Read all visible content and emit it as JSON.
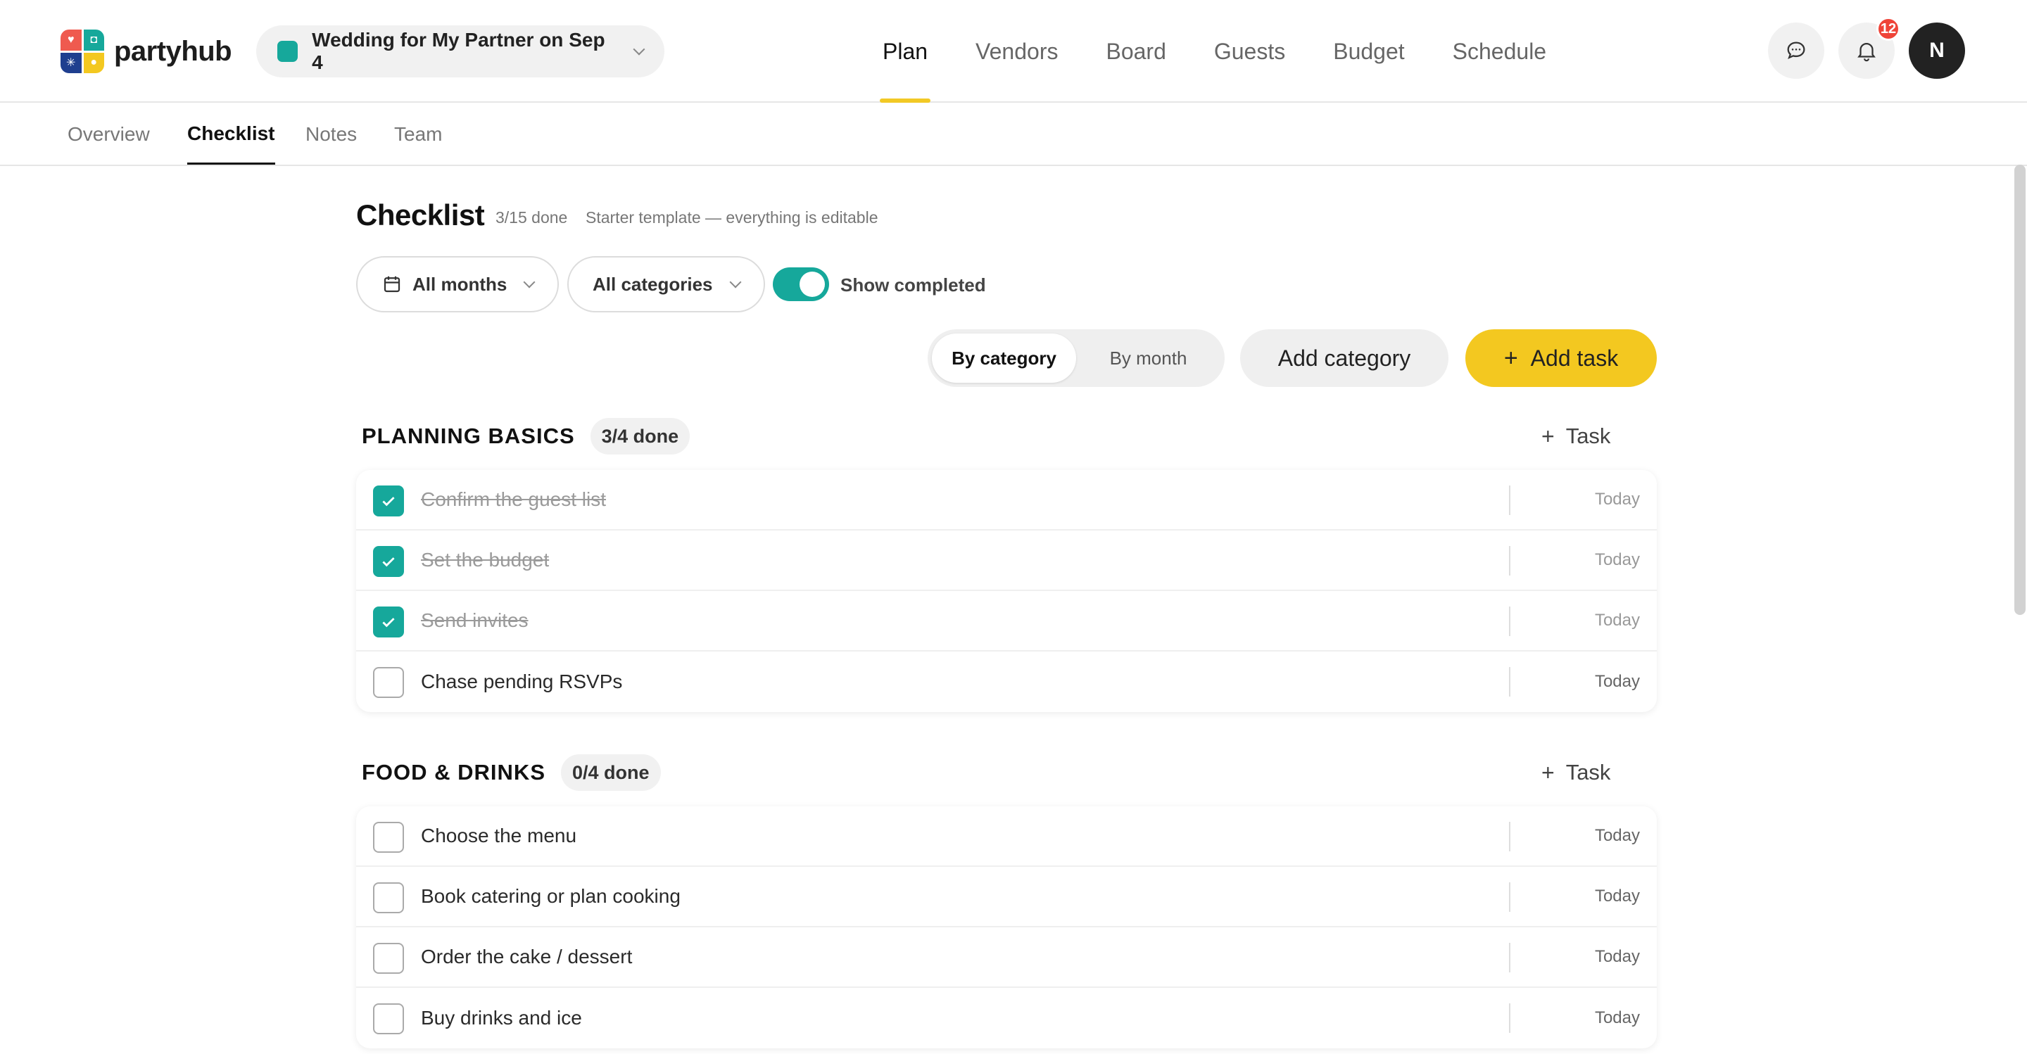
{
  "app": {
    "name": "partyhub",
    "colors": {
      "brand_yellow": "#f3c820",
      "teal": "#16a89b",
      "badge_red": "#ef4438"
    }
  },
  "event": {
    "name": "Wedding for My Partner on Sep 4"
  },
  "main_nav": [
    {
      "label": "Plan",
      "active": true
    },
    {
      "label": "Vendors"
    },
    {
      "label": "Board"
    },
    {
      "label": "Guests"
    },
    {
      "label": "Budget"
    },
    {
      "label": "Schedule"
    }
  ],
  "header": {
    "notifications_count": "12",
    "avatar_initial": "N",
    "icons": [
      "chat-icon",
      "bell-icon"
    ]
  },
  "sub_tabs": [
    {
      "label": "Overview"
    },
    {
      "label": "Checklist",
      "active": true
    },
    {
      "label": "Notes"
    },
    {
      "label": "Team"
    }
  ],
  "checklist": {
    "title": "Checklist",
    "done_summary": "3/15 done",
    "template_note": "Starter template — everything is editable",
    "filters": {
      "months": "All months",
      "categories": "All categories"
    },
    "show_completed": {
      "label": "Show completed",
      "on": true
    },
    "view_toggle": {
      "by_category": "By category",
      "by_month": "By month",
      "selected": "By category"
    },
    "add_category": "Add category",
    "add_task": "Add task"
  },
  "categories": [
    {
      "name": "PLANNING BASICS",
      "count": "3/4 done",
      "add_label": "Task",
      "tasks": [
        {
          "title": "Confirm the guest list",
          "done": true,
          "due": "Today"
        },
        {
          "title": "Set the budget",
          "done": true,
          "due": "Today"
        },
        {
          "title": "Send invites",
          "done": true,
          "due": "Today"
        },
        {
          "title": "Chase pending RSVPs",
          "done": false,
          "due": "Today"
        }
      ]
    },
    {
      "name": "FOOD & DRINKS",
      "count": "0/4 done",
      "add_label": "Task",
      "tasks": [
        {
          "title": "Choose the menu",
          "done": false,
          "due": "Today"
        },
        {
          "title": "Book catering or plan cooking",
          "done": false,
          "due": "Today"
        },
        {
          "title": "Order the cake / dessert",
          "done": false,
          "due": "Today"
        },
        {
          "title": "Buy drinks and ice",
          "done": false,
          "due": "Today"
        }
      ]
    }
  ]
}
